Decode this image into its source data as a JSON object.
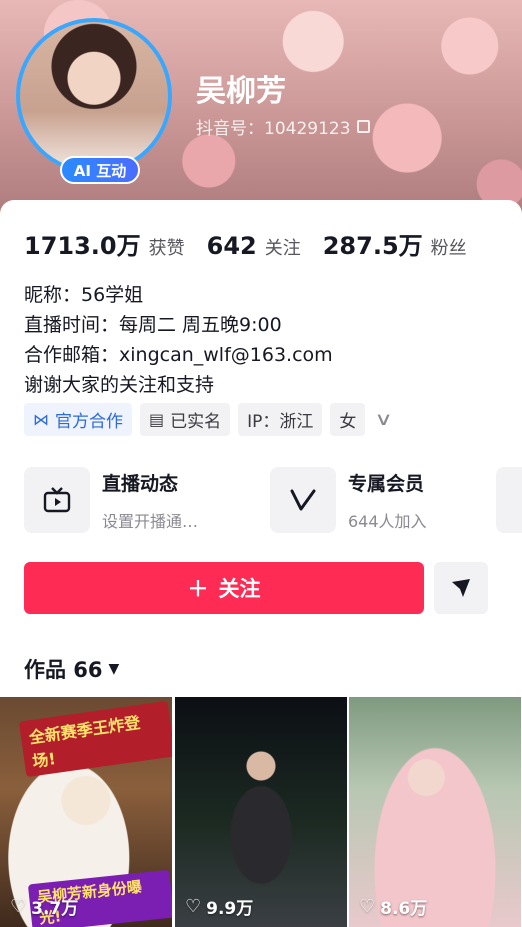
{
  "profile": {
    "name": "吴柳芳",
    "douyin_id": "抖音号：10429123",
    "ai_badge": "AI 互动"
  },
  "stats": [
    {
      "value": "1713.0万",
      "label": "获赞"
    },
    {
      "value": "642",
      "label": "关注"
    },
    {
      "value": "287.5万",
      "label": "粉丝"
    }
  ],
  "bio": [
    "昵称：56学姐",
    "直播时间：每周二 周五晚9:00",
    "合作邮箱：xingcan_wlf@163.com",
    "谢谢大家的关注和支持"
  ],
  "tags": {
    "official": "官方合作",
    "verified": "已实名",
    "ip": "IP：浙江",
    "gender": "女"
  },
  "features": [
    {
      "title": "直播动态",
      "subtitle": "设置开播通…",
      "icon": "tv-icon"
    },
    {
      "title": "专属会员",
      "subtitle": "644人加入",
      "icon": "v-icon"
    }
  ],
  "follow_label": "关注",
  "works": {
    "label": "作品 66",
    "items": [
      {
        "likes": "3.7万",
        "overlay_top": "全新赛季王炸登场!",
        "overlay_bottom": "吴柳芳新身份曝光!"
      },
      {
        "likes": "9.9万"
      },
      {
        "likes": "8.6万"
      }
    ]
  }
}
